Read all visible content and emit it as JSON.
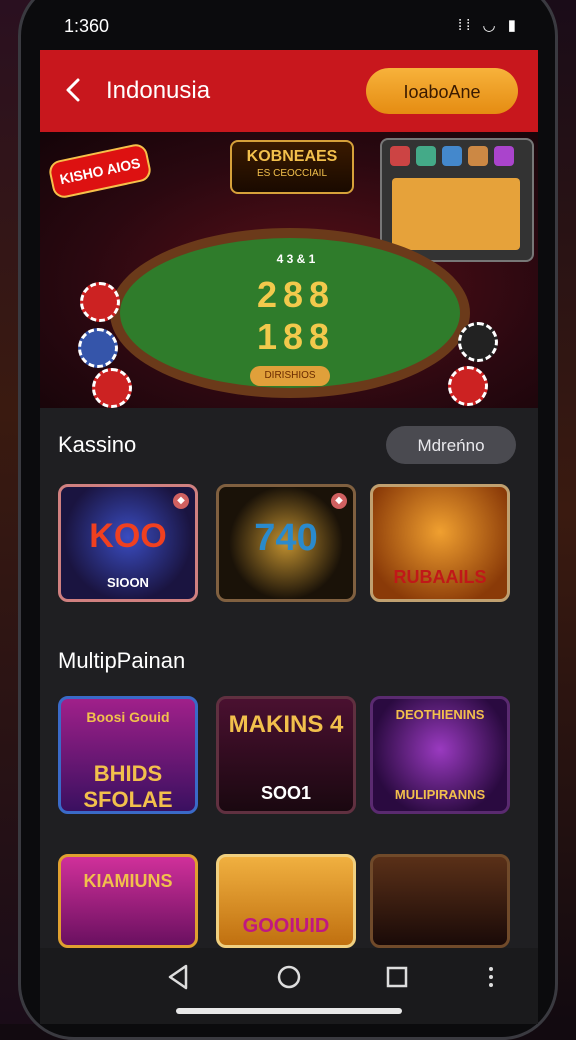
{
  "status_bar": {
    "time": "1:360",
    "icons": "⁞⁞ ◡ ▮"
  },
  "app_bar": {
    "title": "Indonusia",
    "cta_label": "IoaboAne"
  },
  "hero": {
    "promo_tag": "KISHO AIOS",
    "logo_title": "KOBNEAES",
    "logo_sub": "ES CEOCCIAIL",
    "table_numbers_top": "288",
    "table_numbers_bottom": "188",
    "table_plaque": "DIRISHIOS",
    "table_header": "4 3 & 1"
  },
  "casino_section": {
    "title": "Kassino",
    "more_label": "Mdreńno",
    "tiles": [
      {
        "label": "KOO",
        "sub": "SIOON"
      },
      {
        "label": "740",
        "sub": ""
      },
      {
        "label": "RUBAAILS",
        "sub": ""
      }
    ]
  },
  "multi_section": {
    "title": "MultipPainan",
    "tiles": [
      {
        "label": "Boosi Gouid",
        "sub": "BHIDS SFOLAE"
      },
      {
        "label": "MAKINS 4",
        "sub": "SOO1"
      },
      {
        "label": "DEOTHIENINS",
        "sub": "MULIPIRANNS"
      }
    ],
    "tiles_row2": [
      {
        "label": "KIAMIUNS",
        "sub": ""
      },
      {
        "label": "GOOIUID",
        "sub": ""
      },
      {
        "label": "",
        "sub": ""
      }
    ]
  },
  "nav": {
    "back_icon": "triangle-back",
    "home_icon": "circle-home",
    "recents_icon": "square-recents",
    "menu_icon": "dots-menu"
  },
  "colors": {
    "appbar": "#c8171d",
    "cta": "#f0a020",
    "panel": "#1f1f22",
    "pill": "#4a4a50"
  }
}
